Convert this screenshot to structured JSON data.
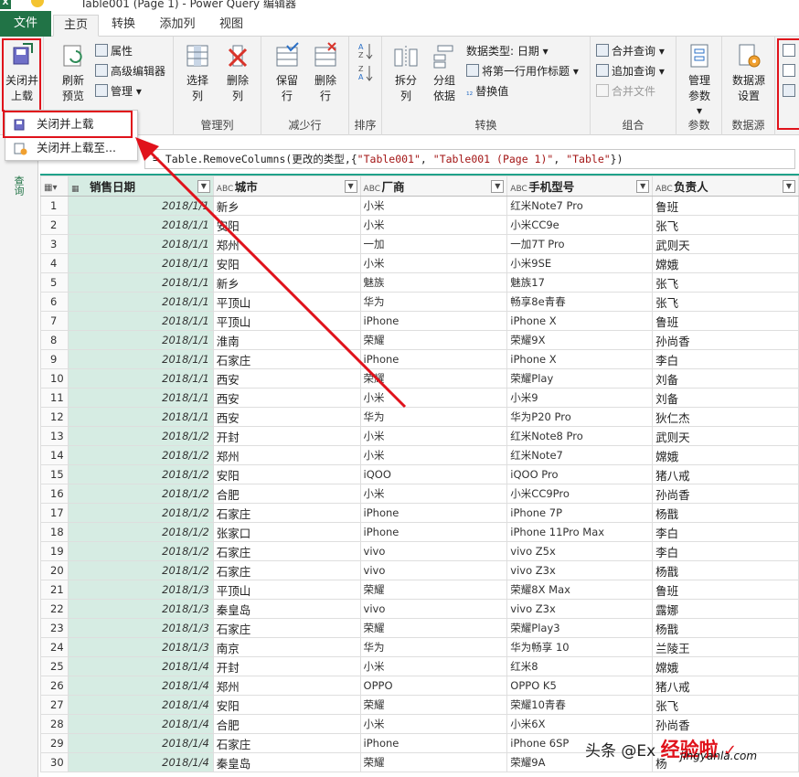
{
  "window": {
    "title": "Table001 (Page 1) - Power Query 编辑器",
    "app_icon": "excel-icon"
  },
  "tabs": [
    {
      "label": "文件"
    },
    {
      "label": "主页"
    },
    {
      "label": "转换"
    },
    {
      "label": "添加列"
    },
    {
      "label": "视图"
    }
  ],
  "ribbon": {
    "close_group": {
      "label_line1": "关闭并",
      "label_line2": "上载"
    },
    "query_group": {
      "refresh_line1": "刷新",
      "refresh_line2": "预览",
      "properties": "属性",
      "advanced_editor": "高级编辑器",
      "manage": "管理"
    },
    "manage_columns": {
      "choose_line1": "选择",
      "choose_line2": "列",
      "remove_line1": "删除",
      "remove_line2": "列",
      "label": "管理列"
    },
    "reduce_rows": {
      "keep_line1": "保留",
      "keep_line2": "行",
      "remove_line1": "删除",
      "remove_line2": "行",
      "label": "减少行"
    },
    "sort": {
      "label": "排序"
    },
    "transform": {
      "split_line1": "拆分",
      "split_line2": "列",
      "group_line1": "分组",
      "group_line2": "依据",
      "data_type": "数据类型: 日期",
      "first_row_header": "将第一行用作标题",
      "replace_values": "替换值",
      "label": "转换"
    },
    "combine": {
      "merge_queries": "合并查询",
      "append_queries": "追加查询",
      "combine_files": "合并文件",
      "label": "组合"
    },
    "parameters": {
      "manage_line1": "管理",
      "manage_line2": "参数",
      "label": "参数"
    },
    "data_source": {
      "settings_line1": "数据源",
      "settings_line2": "设置",
      "label": "数据源"
    }
  },
  "close_menu": {
    "items": [
      {
        "label": "关闭并上载"
      },
      {
        "label": "关闭并上载至..."
      }
    ]
  },
  "left_pane": {
    "label": "查询"
  },
  "formula_bar": {
    "prefix": "= Table.RemoveColumns(更改的类型,{",
    "arg1": "\"Table001\"",
    "sep1": ", ",
    "arg2": "\"Table001 (Page 1)\"",
    "sep2": ", ",
    "arg3": "\"Table\"",
    "suffix": "})"
  },
  "table": {
    "columns": [
      {
        "type": "",
        "name": "销售日期"
      },
      {
        "type": "ABC",
        "name": "城市"
      },
      {
        "type": "ABC",
        "name": "厂商"
      },
      {
        "type": "ABC",
        "name": "手机型号"
      },
      {
        "type": "ABC",
        "name": "负责人"
      }
    ],
    "rows": [
      [
        "1",
        "2018/1/1",
        "新乡",
        "小米",
        "红米Note7 Pro",
        "鲁班"
      ],
      [
        "2",
        "2018/1/1",
        "安阳",
        "小米",
        "小米CC9e",
        "张飞"
      ],
      [
        "3",
        "2018/1/1",
        "郑州",
        "一加",
        "一加7T Pro",
        "武则天"
      ],
      [
        "4",
        "2018/1/1",
        "安阳",
        "小米",
        "小米9SE",
        "嫦娥"
      ],
      [
        "5",
        "2018/1/1",
        "新乡",
        "魅族",
        "魅族17",
        "张飞"
      ],
      [
        "6",
        "2018/1/1",
        "平顶山",
        "华为",
        "畅享8e青春",
        "张飞"
      ],
      [
        "7",
        "2018/1/1",
        "平顶山",
        "iPhone",
        "iPhone X",
        "鲁班"
      ],
      [
        "8",
        "2018/1/1",
        "淮南",
        "荣耀",
        "荣耀9X",
        "孙尚香"
      ],
      [
        "9",
        "2018/1/1",
        "石家庄",
        "iPhone",
        "iPhone X",
        "李白"
      ],
      [
        "10",
        "2018/1/1",
        "西安",
        "荣耀",
        "荣耀Play",
        "刘备"
      ],
      [
        "11",
        "2018/1/1",
        "西安",
        "小米",
        "小米9",
        "刘备"
      ],
      [
        "12",
        "2018/1/1",
        "西安",
        "华为",
        "华为P20 Pro",
        "狄仁杰"
      ],
      [
        "13",
        "2018/1/2",
        "开封",
        "小米",
        "红米Note8 Pro",
        "武则天"
      ],
      [
        "14",
        "2018/1/2",
        "郑州",
        "小米",
        "红米Note7",
        "嫦娥"
      ],
      [
        "15",
        "2018/1/2",
        "安阳",
        "iQOO",
        "iQOO Pro",
        "猪八戒"
      ],
      [
        "16",
        "2018/1/2",
        "合肥",
        "小米",
        "小米CC9Pro",
        "孙尚香"
      ],
      [
        "17",
        "2018/1/2",
        "石家庄",
        "iPhone",
        "iPhone 7P",
        "杨戬"
      ],
      [
        "18",
        "2018/1/2",
        "张家口",
        "iPhone",
        "iPhone 11Pro Max",
        "李白"
      ],
      [
        "19",
        "2018/1/2",
        "石家庄",
        "vivo",
        "vivo Z5x",
        "李白"
      ],
      [
        "20",
        "2018/1/2",
        "石家庄",
        "vivo",
        "vivo Z3x",
        "杨戬"
      ],
      [
        "21",
        "2018/1/3",
        "平顶山",
        "荣耀",
        "荣耀8X Max",
        "鲁班"
      ],
      [
        "22",
        "2018/1/3",
        "秦皇岛",
        "vivo",
        "vivo Z3x",
        "露娜"
      ],
      [
        "23",
        "2018/1/3",
        "石家庄",
        "荣耀",
        "荣耀Play3",
        "杨戬"
      ],
      [
        "24",
        "2018/1/3",
        "南京",
        "华为",
        "华为畅享 10",
        "兰陵王"
      ],
      [
        "25",
        "2018/1/4",
        "开封",
        "小米",
        "红米8",
        "嫦娥"
      ],
      [
        "26",
        "2018/1/4",
        "郑州",
        "OPPO",
        "OPPO K5",
        "猪八戒"
      ],
      [
        "27",
        "2018/1/4",
        "安阳",
        "荣耀",
        "荣耀10青春",
        "张飞"
      ],
      [
        "28",
        "2018/1/4",
        "合肥",
        "小米",
        "小米6X",
        "孙尚香"
      ],
      [
        "29",
        "2018/1/4",
        "石家庄",
        "iPhone",
        "iPhone 6SP",
        ""
      ],
      [
        "30",
        "2018/1/4",
        "秦皇岛",
        "荣耀",
        "荣耀9A",
        "杨"
      ]
    ]
  },
  "watermark": {
    "text_a": "头条 @Ex",
    "text_b": "经验啦",
    "text_c": "jingyanla.com",
    "check": "✓"
  },
  "colors": {
    "accent_green": "#217346",
    "highlight_red": "#e0121b",
    "selected_column": "#d6ece3",
    "column_bar": "#1fa28a"
  }
}
